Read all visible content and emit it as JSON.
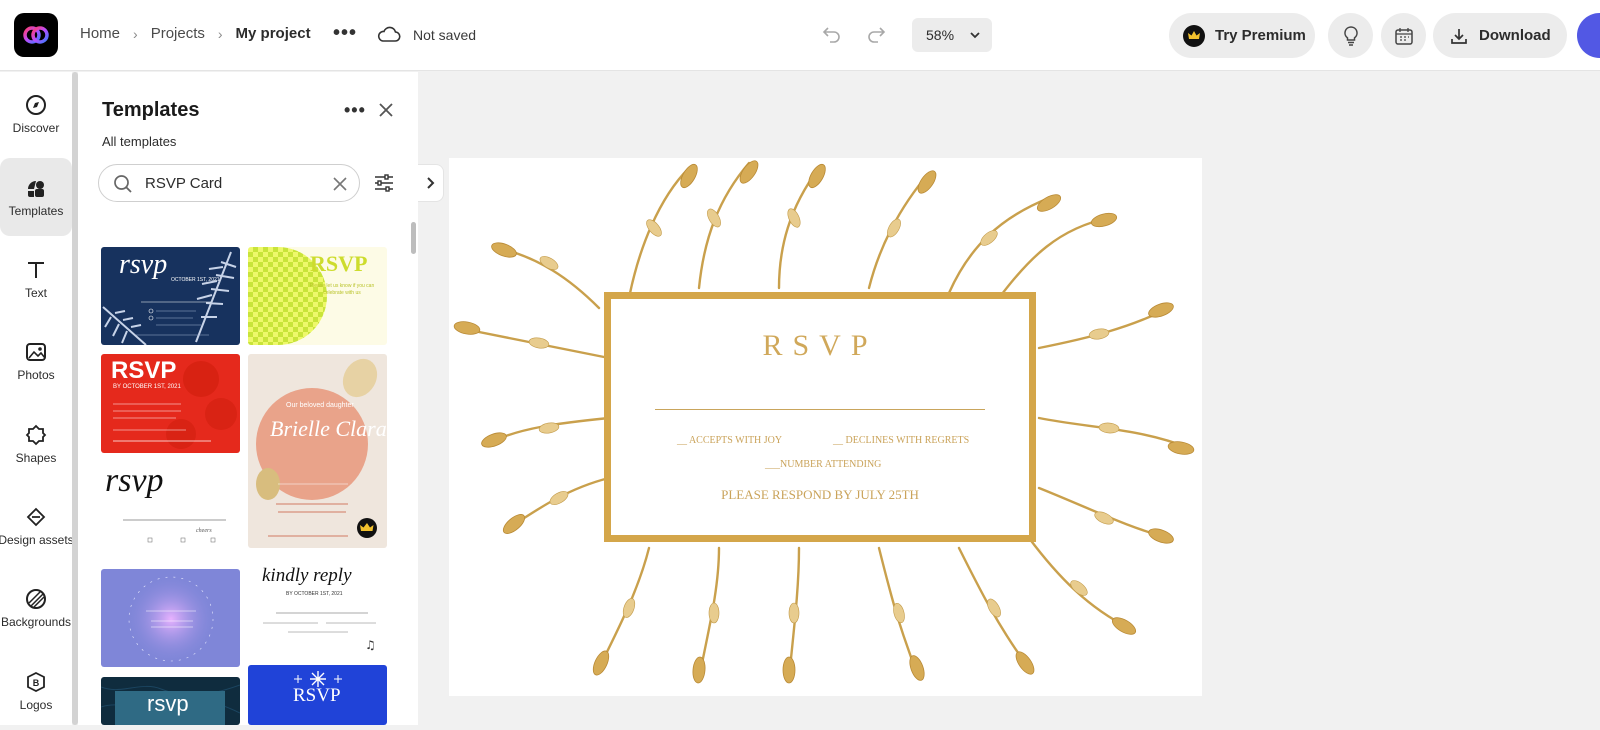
{
  "header": {
    "breadcrumb": [
      "Home",
      "Projects",
      "My project"
    ],
    "save_status": "Not saved",
    "zoom": "58%",
    "premium_label": "Try Premium",
    "download_label": "Download"
  },
  "rail": {
    "items": [
      {
        "label": "Discover",
        "icon": "compass-icon"
      },
      {
        "label": "Templates",
        "icon": "templates-icon"
      },
      {
        "label": "Text",
        "icon": "text-icon"
      },
      {
        "label": "Photos",
        "icon": "photos-icon"
      },
      {
        "label": "Shapes",
        "icon": "shapes-icon"
      },
      {
        "label": "Design assets",
        "icon": "design-assets-icon"
      },
      {
        "label": "Backgrounds",
        "icon": "backgrounds-icon"
      },
      {
        "label": "Logos",
        "icon": "logos-icon"
      }
    ]
  },
  "panel": {
    "title": "Templates",
    "subtitle": "All templates",
    "search_value": "RSVP Card"
  },
  "templates": [
    {
      "text": "rsvp",
      "sub": "OCTOBER 1ST, 2021",
      "bg": "#17325e"
    },
    {
      "text": "RSVP",
      "sub": "Please let us know if you can celebrate with us",
      "bg": "#fdfbe6"
    },
    {
      "text": "RSVP",
      "sub": "BY OCTOBER 1ST, 2021",
      "bg": "#e5291c"
    },
    {
      "text": "Brielle Clara",
      "sub": "Our beloved daughter",
      "bg": "#efe6dd"
    },
    {
      "text": "rsvp",
      "sub": "",
      "bg": "#ffffff"
    },
    {
      "text": "",
      "sub": "",
      "bg": "#7f86d8"
    },
    {
      "text": "kindly reply",
      "sub": "BY OCTOBER 1ST, 2021",
      "bg": "#ffffff"
    },
    {
      "text": "rsvp",
      "sub": "",
      "bg": "#0f2c3e"
    },
    {
      "text": "RSVP",
      "sub": "",
      "bg": "#2043d8"
    }
  ],
  "card": {
    "title": "RSVP",
    "accept": "__ ACCEPTS WITH JOY",
    "decline": "__ DECLINES WITH REGRETS",
    "attending": "___NUMBER ATTENDING",
    "respond": "PLEASE RESPOND BY JULY 25TH"
  },
  "colors": {
    "gold": "#d4a64a",
    "accent": "#5258e4"
  }
}
